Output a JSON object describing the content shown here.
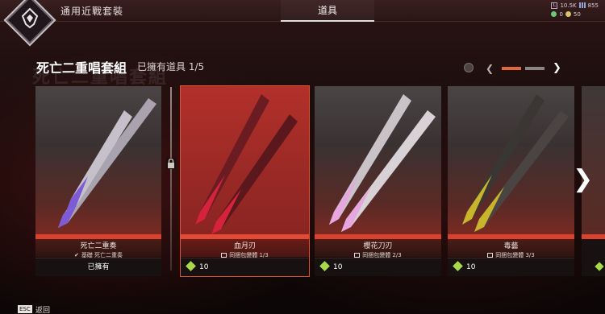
{
  "topbar": {
    "breadcrumb": "通用近戰套裝",
    "active_tab": "道具",
    "currency": {
      "legend_tokens": "10.5K",
      "crafting_metals": "855",
      "green_currency": "0",
      "gold_currency": "50"
    }
  },
  "header": {
    "set_title": "死亡二重唱套組",
    "set_title_shadow": "死亡二重唱套組",
    "owned_count": "已擁有道具 1/5"
  },
  "cards": [
    {
      "name": "死亡二重奏",
      "sub": "基礎 死亡二重奏",
      "footer": "已擁有",
      "blade_color": "#7d5bd6",
      "selected": false
    },
    {
      "name": "血月刃",
      "sub": "同捆包變體 1/3",
      "footer": "10",
      "blade_color": "#d4233a",
      "selected": true
    },
    {
      "name": "櫻花刀刃",
      "sub": "同捆包變體 2/3",
      "footer": "10",
      "blade_color": "#e8a6e0",
      "selected": false
    },
    {
      "name": "毒藝",
      "sub": "同捆包變體 3/3",
      "footer": "10",
      "blade_color": "#c9b52b",
      "selected": false
    }
  ],
  "partial_card": {
    "footer": "10"
  },
  "footer": {
    "esc_key": "ESC",
    "back_label": "返回"
  }
}
